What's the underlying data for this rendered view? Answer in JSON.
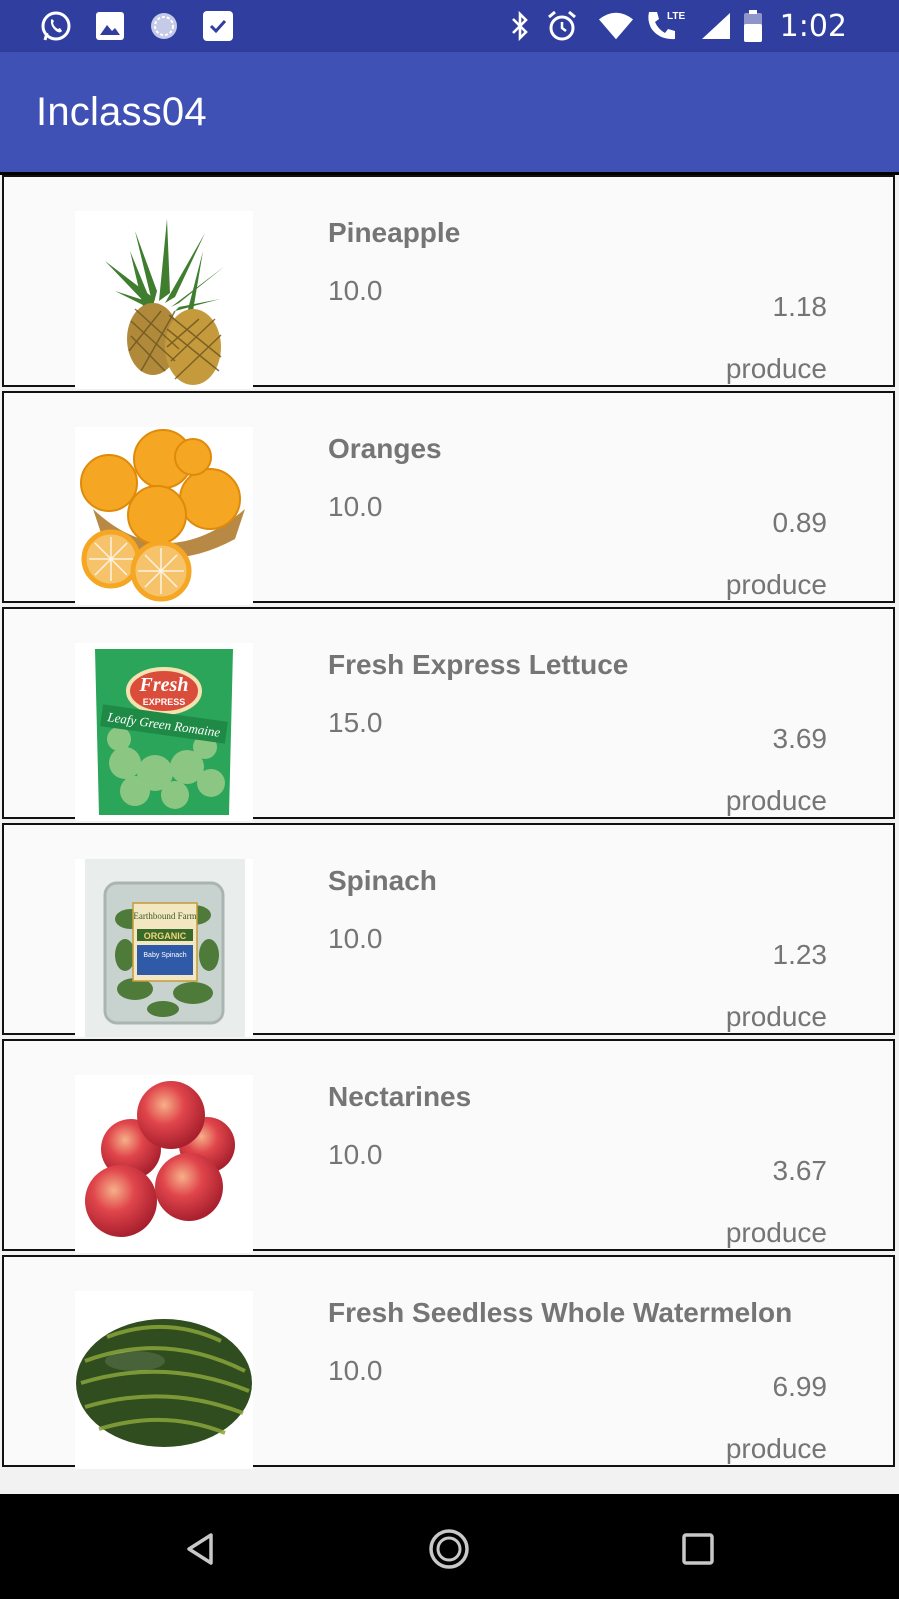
{
  "status_bar": {
    "time": "1:02",
    "left_icons": [
      "whatsapp-icon",
      "gallery-icon",
      "sync-icon",
      "task-check-icon"
    ],
    "right_icons": [
      "bluetooth-icon",
      "alarm-icon",
      "wifi-icon",
      "lte-call-icon",
      "signal-icon",
      "battery-icon"
    ],
    "lte_label": "LTE"
  },
  "app_bar": {
    "title": "Inclass04"
  },
  "products": [
    {
      "name": "Pineapple",
      "quantity": "10.0",
      "price": "1.18",
      "category": "produce",
      "image": "pineapple"
    },
    {
      "name": "Oranges",
      "quantity": "10.0",
      "price": "0.89",
      "category": "produce",
      "image": "oranges"
    },
    {
      "name": "Fresh Express Lettuce",
      "quantity": "15.0",
      "price": "3.69",
      "category": "produce",
      "image": "lettuce-bag"
    },
    {
      "name": "Spinach",
      "quantity": "10.0",
      "price": "1.23",
      "category": "produce",
      "image": "spinach-box"
    },
    {
      "name": "Nectarines",
      "quantity": "10.0",
      "price": "3.67",
      "category": "produce",
      "image": "nectarines"
    },
    {
      "name": "Fresh Seedless Whole Watermelon",
      "quantity": "10.0",
      "price": "6.99",
      "category": "produce",
      "image": "watermelon"
    }
  ],
  "lettuce_label": {
    "brand_top": "Fresh",
    "brand_bottom": "EXPRESS",
    "variety": "Leafy Green Romaine"
  },
  "spinach_label": {
    "brand": "Earthbound Farm",
    "tag": "ORGANIC",
    "variety": "Baby Spinach"
  },
  "nav_bar": {
    "buttons": [
      "back-icon",
      "home-icon",
      "recents-icon"
    ]
  },
  "colors": {
    "status_bar": "#303f9f",
    "app_bar": "#3f51b5",
    "row_bg": "#fafafa",
    "text": "#757575"
  }
}
